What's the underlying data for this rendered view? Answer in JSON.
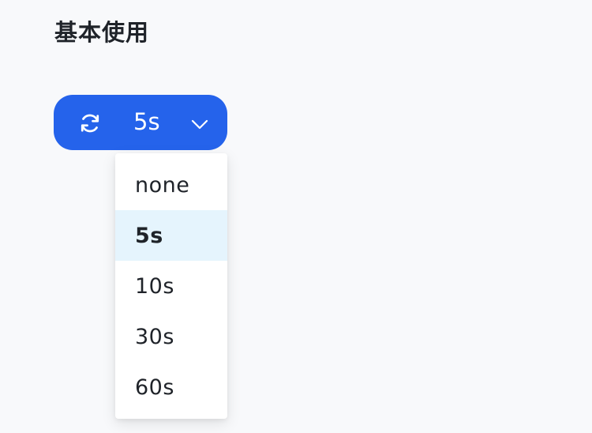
{
  "section": {
    "title": "基本使用"
  },
  "refresh_control": {
    "refresh_icon": "refresh-icon",
    "current_interval": "5s",
    "dropdown_icon": "chevron-down-icon",
    "accent_color": "#2563eb"
  },
  "dropdown": {
    "options": [
      {
        "label": "none",
        "selected": false
      },
      {
        "label": "5s",
        "selected": true
      },
      {
        "label": "10s",
        "selected": false
      },
      {
        "label": "30s",
        "selected": false
      },
      {
        "label": "60s",
        "selected": false
      }
    ],
    "selected_background": "#e5f4fd"
  }
}
